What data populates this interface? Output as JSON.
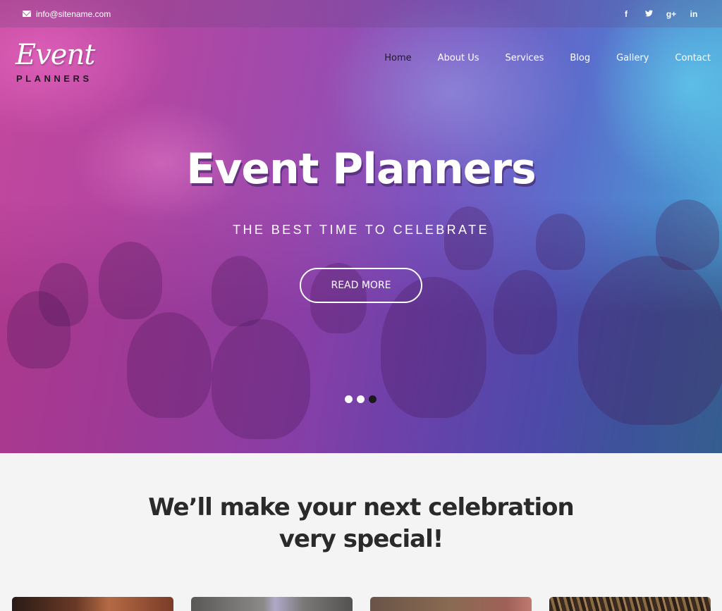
{
  "topbar": {
    "email": "info@sitename.com",
    "social": [
      {
        "name": "facebook-icon",
        "glyph": "f"
      },
      {
        "name": "twitter-icon",
        "glyph": "🐦"
      },
      {
        "name": "google-plus-icon",
        "glyph": "g+"
      },
      {
        "name": "linkedin-icon",
        "glyph": "in"
      }
    ]
  },
  "logo": {
    "script": "Event",
    "sub": "PLANNERS"
  },
  "nav": {
    "items": [
      {
        "label": "Home",
        "active": true
      },
      {
        "label": "About Us",
        "active": false
      },
      {
        "label": "Services",
        "active": false
      },
      {
        "label": "Blog",
        "active": false
      },
      {
        "label": "Gallery",
        "active": false
      },
      {
        "label": "Contact",
        "active": false
      }
    ]
  },
  "hero": {
    "title": "Event Planners",
    "subtitle": "THE BEST TIME TO CELEBRATE",
    "button": "READ MORE",
    "slides": 3,
    "active_slide": 3
  },
  "section": {
    "tagline_line1": "We’ll make your next celebration",
    "tagline_line2": "very special!"
  },
  "cards": [
    {
      "name": "card-1"
    },
    {
      "name": "card-2"
    },
    {
      "name": "card-3"
    },
    {
      "name": "card-4"
    }
  ]
}
